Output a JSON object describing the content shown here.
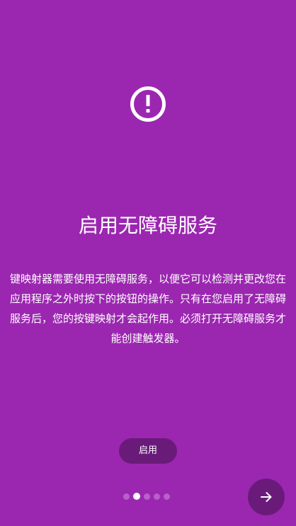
{
  "onboarding": {
    "icon": "alert-circle-icon",
    "title": "启用无障碍服务",
    "description": "键映射器需要使用无障碍服务，以便它可以检测并更改您在应用程序之外时按下的按钮的操作。只有在您启用了无障碍服务后，您的按键映射才会起作用。必须打开无障碍服务才能创建触发器。",
    "enable_label": "启用",
    "next_icon": "arrow-right-icon"
  },
  "pager": {
    "total": 5,
    "current": 2
  },
  "colors": {
    "background": "#9b27b0",
    "button": "#6a1b7a",
    "dot_inactive": "#b761c9",
    "dot_active": "#ffffff"
  }
}
